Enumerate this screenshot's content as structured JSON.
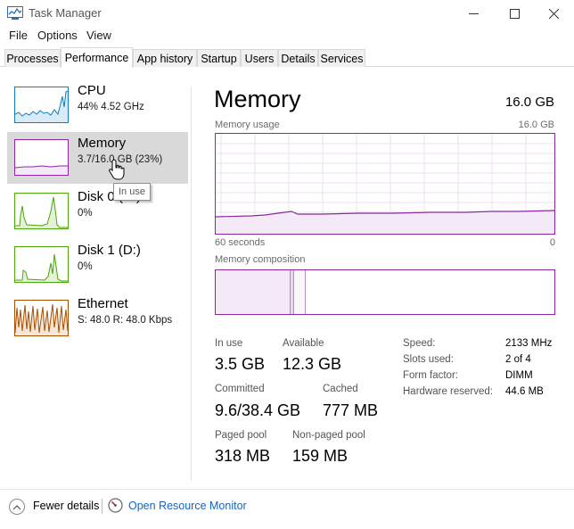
{
  "window": {
    "title": "Task Manager",
    "icon": "task-manager-icon"
  },
  "menu": [
    "File",
    "Options",
    "View"
  ],
  "tabs": [
    "Processes",
    "Performance",
    "App history",
    "Startup",
    "Users",
    "Details",
    "Services"
  ],
  "active_tab": "Performance",
  "sidebar": {
    "items": [
      {
        "name": "CPU",
        "detail": "44% 4.52 GHz",
        "color": "#117dbb"
      },
      {
        "name": "Memory",
        "detail": "3.7/16.0 GB (23%)",
        "color": "#8b27a1"
      },
      {
        "name": "Disk 0 (C:)",
        "detail": "0%",
        "color": "#4da60c"
      },
      {
        "name": "Disk 1 (D:)",
        "detail": "0%",
        "color": "#4da60c"
      },
      {
        "name": "Ethernet",
        "detail": "S: 48.0  R: 48.0 Kbps",
        "color": "#a74f01"
      }
    ],
    "selected": "Memory"
  },
  "tooltip": "In use",
  "main": {
    "title": "Memory",
    "total": "16.0 GB",
    "usage_label": "Memory usage",
    "usage_max": "16.0 GB",
    "time_left": "60 seconds",
    "time_right": "0",
    "composition_label": "Memory composition",
    "accent": "#8b27a1"
  },
  "stats": {
    "in_use_label": "In use",
    "in_use": "3.5 GB",
    "available_label": "Available",
    "available": "12.3 GB",
    "committed_label": "Committed",
    "committed": "9.6/38.4 GB",
    "cached_label": "Cached",
    "cached": "777 MB",
    "paged_label": "Paged pool",
    "paged": "318 MB",
    "nonpaged_label": "Non-paged pool",
    "nonpaged": "159 MB"
  },
  "specs": [
    {
      "label": "Speed:",
      "value": "2133 MHz"
    },
    {
      "label": "Slots used:",
      "value": "2 of 4"
    },
    {
      "label": "Form factor:",
      "value": "DIMM"
    },
    {
      "label": "Hardware reserved:",
      "value": "44.6 MB"
    }
  ],
  "footer": {
    "fewer": "Fewer details",
    "monitor": "Open Resource Monitor"
  }
}
